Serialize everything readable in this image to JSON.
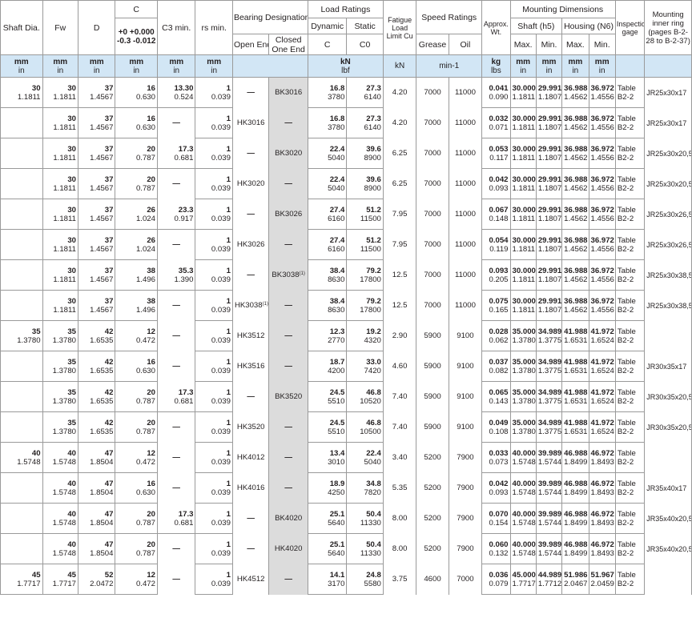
{
  "header": {
    "shaft_dia": "Shaft Dia.",
    "fw": "Fw",
    "d": "D",
    "c": "C",
    "c_tol_upper": "+0  +0.000",
    "c_tol_lower": "-0.3  -0.012",
    "c3": "C3 min.",
    "rs": "rs min.",
    "bearing_designation": "Bearing Designation",
    "open_ends": "Open Ends",
    "closed_one_end": "Closed One End",
    "load_ratings": "Load Ratings",
    "dynamic": "Dynamic",
    "static": "Static",
    "dyn_c": "C",
    "stat_c0": "C0",
    "fatigue": "Fatigue Load Limit Cu",
    "speed_ratings": "Speed Ratings",
    "grease": "Grease",
    "oil": "Oil",
    "approx_wt": "Approx. Wt.",
    "mounting_dimensions": "Mounting Dimensions",
    "shaft_h5": "Shaft (h5)",
    "housing_n6": "Housing (N6)",
    "max": "Max.",
    "min": "Min.",
    "inspection_gage": "Inspection gage",
    "mounting_inner_ring": "Mounting inner ring (pages B-2-28 to B-2-37)"
  },
  "units": {
    "mm": "mm",
    "in": "in",
    "kn": "kN",
    "lbf": "lbf",
    "kn_only": "kN",
    "min1": "min-1",
    "kg": "kg",
    "lbs": "lbs"
  },
  "rows": [
    {
      "shaft": [
        "30",
        "1.1811"
      ],
      "fw": [
        "30",
        "1.1811"
      ],
      "d": [
        "37",
        "1.4567"
      ],
      "c": [
        "16",
        "0.630"
      ],
      "c3": [
        "13.30",
        "0.524"
      ],
      "rs": [
        "1",
        "0.039"
      ],
      "open": "—",
      "closed": "BK3016",
      "dyn": [
        "16.8",
        "3780"
      ],
      "stat": [
        "27.3",
        "6140"
      ],
      "cu": "4.20",
      "grease": "7000",
      "oil": "11000",
      "wt": [
        "0.041",
        "0.090"
      ],
      "smax": [
        "30.000",
        "1.1811"
      ],
      "smin": [
        "29.991",
        "1.1807"
      ],
      "hmax": [
        "36.988",
        "1.4562"
      ],
      "hmin": [
        "36.972",
        "1.4556"
      ],
      "gage": [
        "Table",
        "B2-2"
      ],
      "ring": "JR25x30x17"
    },
    {
      "shaft": [
        "",
        ""
      ],
      "fw": [
        "30",
        "1.1811"
      ],
      "d": [
        "37",
        "1.4567"
      ],
      "c": [
        "16",
        "0.630"
      ],
      "c3": [
        "—",
        ""
      ],
      "rs": [
        "1",
        "0.039"
      ],
      "open": "HK3016",
      "closed": "—",
      "dyn": [
        "16.8",
        "3780"
      ],
      "stat": [
        "27.3",
        "6140"
      ],
      "cu": "4.20",
      "grease": "7000",
      "oil": "11000",
      "wt": [
        "0.032",
        "0.071"
      ],
      "smax": [
        "30.000",
        "1.1811"
      ],
      "smin": [
        "29.991",
        "1.1807"
      ],
      "hmax": [
        "36.988",
        "1.4562"
      ],
      "hmin": [
        "36.972",
        "1.4556"
      ],
      "gage": [
        "Table",
        "B2-2"
      ],
      "ring": "JR25x30x17"
    },
    {
      "shaft": [
        "",
        ""
      ],
      "fw": [
        "30",
        "1.1811"
      ],
      "d": [
        "37",
        "1.4567"
      ],
      "c": [
        "20",
        "0.787"
      ],
      "c3": [
        "17.3",
        "0.681"
      ],
      "rs": [
        "1",
        "0.039"
      ],
      "open": "—",
      "closed": "BK3020",
      "dyn": [
        "22.4",
        "5040"
      ],
      "stat": [
        "39.6",
        "8900"
      ],
      "cu": "6.25",
      "grease": "7000",
      "oil": "11000",
      "wt": [
        "0.053",
        "0.117"
      ],
      "smax": [
        "30.000",
        "1.1811"
      ],
      "smin": [
        "29.991",
        "1.1807"
      ],
      "hmax": [
        "36.988",
        "1.4562"
      ],
      "hmin": [
        "36.972",
        "1.4556"
      ],
      "gage": [
        "Table",
        "B2-2"
      ],
      "ring": "JR25x30x20,5"
    },
    {
      "shaft": [
        "",
        ""
      ],
      "fw": [
        "30",
        "1.1811"
      ],
      "d": [
        "37",
        "1.4567"
      ],
      "c": [
        "20",
        "0.787"
      ],
      "c3": [
        "—",
        ""
      ],
      "rs": [
        "1",
        "0.039"
      ],
      "open": "HK3020",
      "closed": "—",
      "dyn": [
        "22.4",
        "5040"
      ],
      "stat": [
        "39.6",
        "8900"
      ],
      "cu": "6.25",
      "grease": "7000",
      "oil": "11000",
      "wt": [
        "0.042",
        "0.093"
      ],
      "smax": [
        "30.000",
        "1.1811"
      ],
      "smin": [
        "29.991",
        "1.1807"
      ],
      "hmax": [
        "36.988",
        "1.4562"
      ],
      "hmin": [
        "36.972",
        "1.4556"
      ],
      "gage": [
        "Table",
        "B2-2"
      ],
      "ring": "JR25x30x20,5"
    },
    {
      "shaft": [
        "",
        ""
      ],
      "fw": [
        "30",
        "1.1811"
      ],
      "d": [
        "37",
        "1.4567"
      ],
      "c": [
        "26",
        "1.024"
      ],
      "c3": [
        "23.3",
        "0.917"
      ],
      "rs": [
        "1",
        "0.039"
      ],
      "open": "—",
      "closed": "BK3026",
      "dyn": [
        "27.4",
        "6160"
      ],
      "stat": [
        "51.2",
        "11500"
      ],
      "cu": "7.95",
      "grease": "7000",
      "oil": "11000",
      "wt": [
        "0.067",
        "0.148"
      ],
      "smax": [
        "30.000",
        "1.1811"
      ],
      "smin": [
        "29.991",
        "1.1807"
      ],
      "hmax": [
        "36.988",
        "1.4562"
      ],
      "hmin": [
        "36.972",
        "1.4556"
      ],
      "gage": [
        "Table",
        "B2-2"
      ],
      "ring": "JR25x30x26,5"
    },
    {
      "shaft": [
        "",
        ""
      ],
      "fw": [
        "30",
        "1.1811"
      ],
      "d": [
        "37",
        "1.4567"
      ],
      "c": [
        "26",
        "1.024"
      ],
      "c3": [
        "—",
        ""
      ],
      "rs": [
        "1",
        "0.039"
      ],
      "open": "HK3026",
      "closed": "—",
      "dyn": [
        "27.4",
        "6160"
      ],
      "stat": [
        "51.2",
        "11500"
      ],
      "cu": "7.95",
      "grease": "7000",
      "oil": "11000",
      "wt": [
        "0.054",
        "0.119"
      ],
      "smax": [
        "30.000",
        "1.1811"
      ],
      "smin": [
        "29.991",
        "1.1807"
      ],
      "hmax": [
        "36.988",
        "1.4562"
      ],
      "hmin": [
        "36.972",
        "1.4556"
      ],
      "gage": [
        "Table",
        "B2-2"
      ],
      "ring": "JR25x30x26,5"
    },
    {
      "shaft": [
        "",
        ""
      ],
      "fw": [
        "30",
        "1.1811"
      ],
      "d": [
        "37",
        "1.4567"
      ],
      "c": [
        "38",
        "1.496"
      ],
      "c3": [
        "35.3",
        "1.390"
      ],
      "rs": [
        "1",
        "0.039"
      ],
      "open": "—",
      "closed": "BK3038",
      "closed_sup": "(1)",
      "dyn": [
        "38.4",
        "8630"
      ],
      "stat": [
        "79.2",
        "17800"
      ],
      "cu": "12.5",
      "grease": "7000",
      "oil": "11000",
      "wt": [
        "0.093",
        "0.205"
      ],
      "smax": [
        "30.000",
        "1.1811"
      ],
      "smin": [
        "29.991",
        "1.1807"
      ],
      "hmax": [
        "36.988",
        "1.4562"
      ],
      "hmin": [
        "36.972",
        "1.4556"
      ],
      "gage": [
        "Table",
        "B2-2"
      ],
      "ring": "JR25x30x38,5"
    },
    {
      "shaft": [
        "",
        ""
      ],
      "fw": [
        "30",
        "1.1811"
      ],
      "d": [
        "37",
        "1.4567"
      ],
      "c": [
        "38",
        "1.496"
      ],
      "c3": [
        "—",
        ""
      ],
      "rs": [
        "1",
        "0.039"
      ],
      "open": "HK3038",
      "open_sup": "(1)",
      "closed": "—",
      "dyn": [
        "38.4",
        "8630"
      ],
      "stat": [
        "79.2",
        "17800"
      ],
      "cu": "12.5",
      "grease": "7000",
      "oil": "11000",
      "wt": [
        "0.075",
        "0.165"
      ],
      "smax": [
        "30.000",
        "1.1811"
      ],
      "smin": [
        "29.991",
        "1.1807"
      ],
      "hmax": [
        "36.988",
        "1.4562"
      ],
      "hmin": [
        "36.972",
        "1.4556"
      ],
      "gage": [
        "Table",
        "B2-2"
      ],
      "ring": "JR25x30x38,5"
    },
    {
      "shaft": [
        "35",
        "1.3780"
      ],
      "fw": [
        "35",
        "1.3780"
      ],
      "d": [
        "42",
        "1.6535"
      ],
      "c": [
        "12",
        "0.472"
      ],
      "c3": [
        "—",
        ""
      ],
      "rs": [
        "1",
        "0.039"
      ],
      "open": "HK3512",
      "closed": "—",
      "dyn": [
        "12.3",
        "2770"
      ],
      "stat": [
        "19.2",
        "4320"
      ],
      "cu": "2.90",
      "grease": "5900",
      "oil": "9100",
      "wt": [
        "0.028",
        "0.062"
      ],
      "smax": [
        "35.000",
        "1.3780"
      ],
      "smin": [
        "34.989",
        "1.3775"
      ],
      "hmax": [
        "41.988",
        "1.6531"
      ],
      "hmin": [
        "41.972",
        "1.6524"
      ],
      "gage": [
        "Table",
        "B2-2"
      ],
      "ring": ""
    },
    {
      "shaft": [
        "",
        ""
      ],
      "fw": [
        "35",
        "1.3780"
      ],
      "d": [
        "42",
        "1.6535"
      ],
      "c": [
        "16",
        "0.630"
      ],
      "c3": [
        "—",
        ""
      ],
      "rs": [
        "1",
        "0.039"
      ],
      "open": "HK3516",
      "closed": "—",
      "dyn": [
        "18.7",
        "4200"
      ],
      "stat": [
        "33.0",
        "7420"
      ],
      "cu": "4.60",
      "grease": "5900",
      "oil": "9100",
      "wt": [
        "0.037",
        "0.082"
      ],
      "smax": [
        "35.000",
        "1.3780"
      ],
      "smin": [
        "34.989",
        "1.3775"
      ],
      "hmax": [
        "41.988",
        "1.6531"
      ],
      "hmin": [
        "41.972",
        "1.6524"
      ],
      "gage": [
        "Table",
        "B2-2"
      ],
      "ring": "JR30x35x17"
    },
    {
      "shaft": [
        "",
        ""
      ],
      "fw": [
        "35",
        "1.3780"
      ],
      "d": [
        "42",
        "1.6535"
      ],
      "c": [
        "20",
        "0.787"
      ],
      "c3": [
        "17.3",
        "0.681"
      ],
      "rs": [
        "1",
        "0.039"
      ],
      "open": "—",
      "closed": "BK3520",
      "dyn": [
        "24.5",
        "5510"
      ],
      "stat": [
        "46.8",
        "10520"
      ],
      "cu": "7.40",
      "grease": "5900",
      "oil": "9100",
      "wt": [
        "0.065",
        "0.143"
      ],
      "smax": [
        "35.000",
        "1.3780"
      ],
      "smin": [
        "34.989",
        "1.3775"
      ],
      "hmax": [
        "41.988",
        "1.6531"
      ],
      "hmin": [
        "41.972",
        "1.6524"
      ],
      "gage": [
        "Table",
        "B2-2"
      ],
      "ring": "JR30x35x20,5"
    },
    {
      "shaft": [
        "",
        ""
      ],
      "fw": [
        "35",
        "1.3780"
      ],
      "d": [
        "42",
        "1.6535"
      ],
      "c": [
        "20",
        "0.787"
      ],
      "c3": [
        "—",
        ""
      ],
      "rs": [
        "1",
        "0.039"
      ],
      "open": "HK3520",
      "closed": "—",
      "dyn": [
        "24.5",
        "5510"
      ],
      "stat": [
        "46.8",
        "10500"
      ],
      "cu": "7.40",
      "grease": "5900",
      "oil": "9100",
      "wt": [
        "0.049",
        "0.108"
      ],
      "smax": [
        "35.000",
        "1.3780"
      ],
      "smin": [
        "34.989",
        "1.3775"
      ],
      "hmax": [
        "41.988",
        "1.6531"
      ],
      "hmin": [
        "41.972",
        "1.6524"
      ],
      "gage": [
        "Table",
        "B2-2"
      ],
      "ring": "JR30x35x20,5"
    },
    {
      "shaft": [
        "40",
        "1.5748"
      ],
      "fw": [
        "40",
        "1.5748"
      ],
      "d": [
        "47",
        "1.8504"
      ],
      "c": [
        "12",
        "0.472"
      ],
      "c3": [
        "—",
        ""
      ],
      "rs": [
        "1",
        "0.039"
      ],
      "open": "HK4012",
      "closed": "—",
      "dyn": [
        "13.4",
        "3010"
      ],
      "stat": [
        "22.4",
        "5040"
      ],
      "cu": "3.40",
      "grease": "5200",
      "oil": "7900",
      "wt": [
        "0.033",
        "0.073"
      ],
      "smax": [
        "40.000",
        "1.5748"
      ],
      "smin": [
        "39.989",
        "1.5744"
      ],
      "hmax": [
        "46.988",
        "1.8499"
      ],
      "hmin": [
        "46.972",
        "1.8493"
      ],
      "gage": [
        "Table",
        "B2-2"
      ],
      "ring": ""
    },
    {
      "shaft": [
        "",
        ""
      ],
      "fw": [
        "40",
        "1.5748"
      ],
      "d": [
        "47",
        "1.8504"
      ],
      "c": [
        "16",
        "0.630"
      ],
      "c3": [
        "—",
        ""
      ],
      "rs": [
        "1",
        "0.039"
      ],
      "open": "HK4016",
      "closed": "—",
      "dyn": [
        "18.9",
        "4250"
      ],
      "stat": [
        "34.8",
        "7820"
      ],
      "cu": "5.35",
      "grease": "5200",
      "oil": "7900",
      "wt": [
        "0.042",
        "0.093"
      ],
      "smax": [
        "40.000",
        "1.5748"
      ],
      "smin": [
        "39.989",
        "1.5744"
      ],
      "hmax": [
        "46.988",
        "1.8499"
      ],
      "hmin": [
        "46.972",
        "1.8493"
      ],
      "gage": [
        "Table",
        "B2-2"
      ],
      "ring": "JR35x40x17"
    },
    {
      "shaft": [
        "",
        ""
      ],
      "fw": [
        "40",
        "1.5748"
      ],
      "d": [
        "47",
        "1.8504"
      ],
      "c": [
        "20",
        "0.787"
      ],
      "c3": [
        "17.3",
        "0.681"
      ],
      "rs": [
        "1",
        "0.039"
      ],
      "open": "—",
      "closed": "BK4020",
      "dyn": [
        "25.1",
        "5640"
      ],
      "stat": [
        "50.4",
        "11330"
      ],
      "cu": "8.00",
      "grease": "5200",
      "oil": "7900",
      "wt": [
        "0.070",
        "0.154"
      ],
      "smax": [
        "40.000",
        "1.5748"
      ],
      "smin": [
        "39.989",
        "1.5744"
      ],
      "hmax": [
        "46.988",
        "1.8499"
      ],
      "hmin": [
        "46.972",
        "1.8493"
      ],
      "gage": [
        "Table",
        "B2-2"
      ],
      "ring": "JR35x40x20,5"
    },
    {
      "shaft": [
        "",
        ""
      ],
      "fw": [
        "40",
        "1.5748"
      ],
      "d": [
        "47",
        "1.8504"
      ],
      "c": [
        "20",
        "0.787"
      ],
      "c3": [
        "—",
        ""
      ],
      "rs": [
        "1",
        "0.039"
      ],
      "open": "—",
      "closed": "HK4020",
      "dyn": [
        "25.1",
        "5640"
      ],
      "stat": [
        "50.4",
        "11330"
      ],
      "cu": "8.00",
      "grease": "5200",
      "oil": "7900",
      "wt": [
        "0.060",
        "0.132"
      ],
      "smax": [
        "40.000",
        "1.5748"
      ],
      "smin": [
        "39.989",
        "1.5744"
      ],
      "hmax": [
        "46.988",
        "1.8499"
      ],
      "hmin": [
        "46.972",
        "1.8493"
      ],
      "gage": [
        "Table",
        "B2-2"
      ],
      "ring": "JR35x40x20,5"
    },
    {
      "shaft": [
        "45",
        "1.7717"
      ],
      "fw": [
        "45",
        "1.7717"
      ],
      "d": [
        "52",
        "2.0472"
      ],
      "c": [
        "12",
        "0.472"
      ],
      "c3": [
        "—",
        ""
      ],
      "rs": [
        "1",
        "0.039"
      ],
      "open": "HK4512",
      "closed": "—",
      "dyn": [
        "14.1",
        "3170"
      ],
      "stat": [
        "24.8",
        "5580"
      ],
      "cu": "3.75",
      "grease": "4600",
      "oil": "7000",
      "wt": [
        "0.036",
        "0.079"
      ],
      "smax": [
        "45.000",
        "1.7717"
      ],
      "smin": [
        "44.989",
        "1.7712"
      ],
      "hmax": [
        "51.986",
        "2.0467"
      ],
      "hmin": [
        "51.967",
        "2.0459"
      ],
      "gage": [
        "Table",
        "B2-2"
      ],
      "ring": ""
    }
  ]
}
